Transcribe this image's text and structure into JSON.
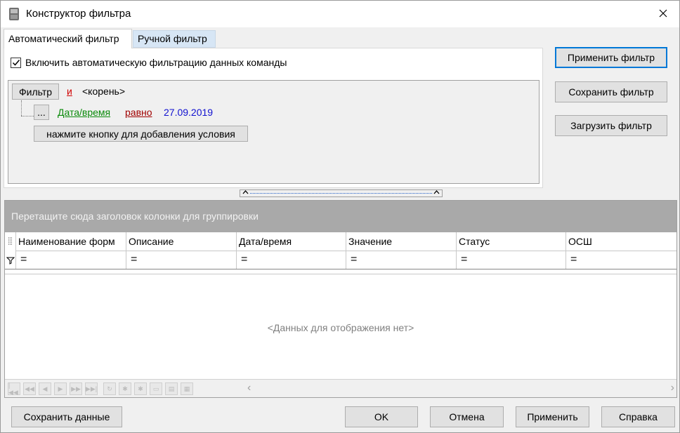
{
  "window": {
    "title": "Конструктор фильтра"
  },
  "tabs": [
    {
      "label": "Автоматический фильтр",
      "active": true
    },
    {
      "label": "Ручной фильтр",
      "active": false
    }
  ],
  "auto_filter": {
    "checkbox_label": "Включить автоматическую фильтрацию данных команды",
    "checked": true,
    "filter_button": "Фильтр",
    "group_operator": "и",
    "root_label": "<корень>",
    "condition": {
      "button": "...",
      "field": "Дата/время",
      "operator": "равно",
      "value": "27.09.2019"
    },
    "add_condition_button": "нажмите кнопку для добавления условия"
  },
  "side_buttons": {
    "apply_filter": "Применить фильтр",
    "save_filter": "Сохранить фильтр",
    "load_filter": "Загрузить фильтр"
  },
  "grid": {
    "group_panel_text": "Перетащите сюда заголовок колонки для группировки",
    "columns": [
      "Наименование форм",
      "Описание",
      "Дата/время",
      "Значение",
      "Статус",
      "ОСШ"
    ],
    "filter_symbol": "=",
    "empty_text": "<Данных для отображения нет>"
  },
  "bottom_buttons": {
    "save_data": "Сохранить данные",
    "ok": "OK",
    "cancel": "Отмена",
    "apply": "Применить",
    "help": "Справка"
  },
  "colors": {
    "accent": "#0078d7",
    "operator_and": "#d00000",
    "field": "#0a8a0a",
    "operator": "#a00000",
    "value": "#1010d0",
    "group_panel": "#a9a9a9"
  }
}
